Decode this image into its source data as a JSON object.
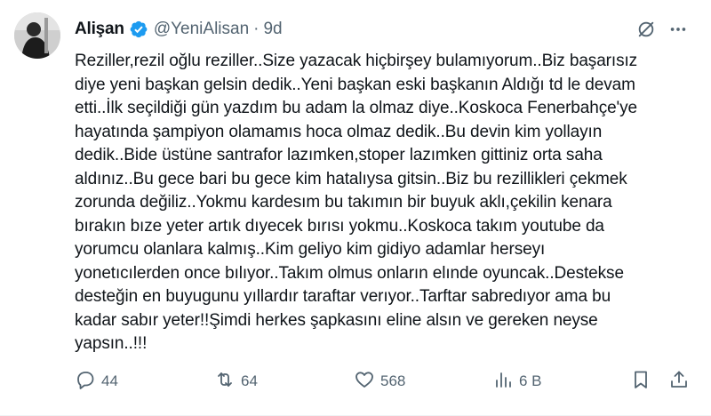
{
  "author": {
    "display_name": "Alişan",
    "handle": "@YeniAlisan",
    "separator": "·",
    "time": "9d",
    "verified": true
  },
  "tweet": {
    "lines": [
      "Reziller,rezil oğlu reziller..Size yazacak hiçbirşey bulamıyorum..Biz başarısız",
      "diye yeni başkan gelsin dedik..Yeni başkan eski başkanın Aldığı td le devam",
      "etti..İlk seçildiği gün yazdım bu adam la olmaz diye..Koskoca Fenerbahçe'ye",
      "hayatında şampiyon olamamıs hoca olmaz dedik..Bu devin kim yollayın",
      "dedik..Bide üstüne santrafor lazımken,stoper lazımken gittiniz orta saha",
      "aldınız..Bu gece bari bu gece kim hatalıysa gitsin..Biz bu rezillikleri çekmek",
      "zorunda değiliz..Yokmu kardesım bu takımın bir buyuk aklı,çekilin kenara",
      "bırakın bıze yeter artık dıyecek bırısı yokmu..Koskoca takım youtube da",
      "yorumcu olanlara kalmış..Kim geliyo kim gidiyo adamlar herseyı",
      "yonetıcılerden once bılıyor..Takım olmus onların elınde oyuncak..Destekse",
      "desteğin en buyugunu yıllardır taraftar verıyor..Tarftar sabredıyor ama bu",
      "kadar sabır yeter!!Şimdi herkes şapkasını eline alsın ve gereken neyse",
      "yapsın..!!!"
    ]
  },
  "actions": {
    "replies": "44",
    "reposts": "64",
    "likes": "568",
    "views": "6 B"
  },
  "colors": {
    "text": "#0f1419",
    "secondary": "#536471",
    "verified": "#1d9bf0"
  },
  "icons": [
    "verified-badge-icon",
    "grok-icon",
    "more-icon",
    "reply-icon",
    "repost-icon",
    "like-icon",
    "views-icon",
    "bookmark-icon",
    "share-icon"
  ]
}
